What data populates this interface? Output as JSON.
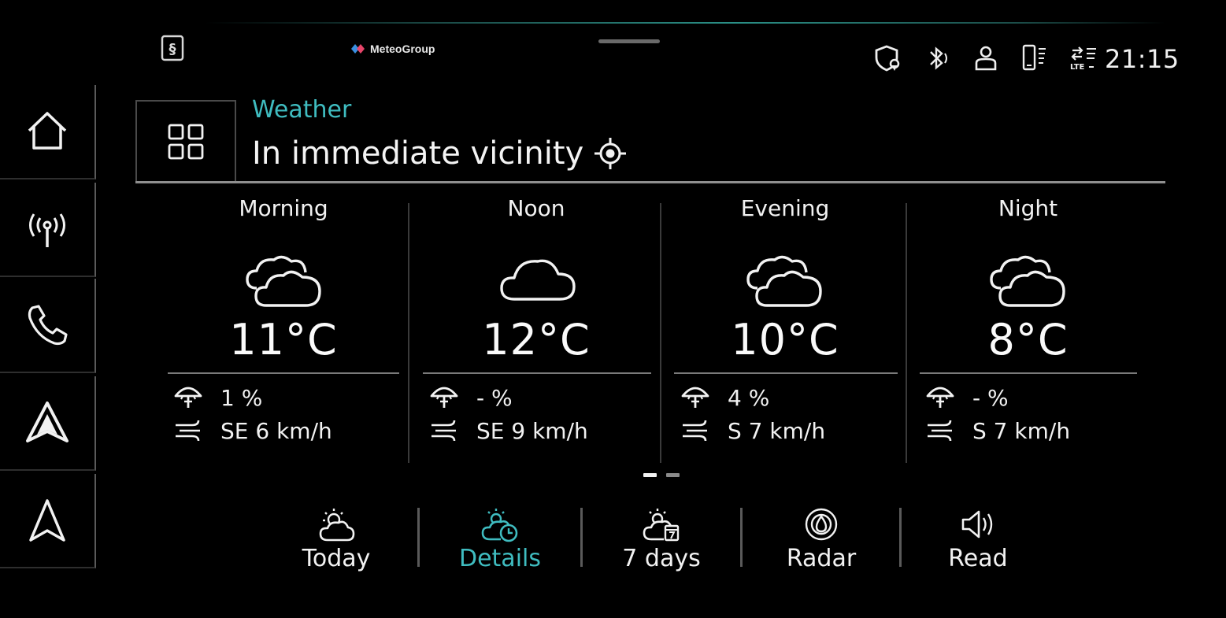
{
  "status_bar": {
    "brand": "MeteoGroup",
    "time": "21:15",
    "icons": [
      "shield-location-icon",
      "bluetooth-icon",
      "user-profile-icon",
      "phone-signal-icon",
      "lte-data-icon"
    ]
  },
  "rail": {
    "items": [
      {
        "name": "home-icon"
      },
      {
        "name": "radio-antenna-icon"
      },
      {
        "name": "phone-icon"
      },
      {
        "name": "android-auto-icon"
      },
      {
        "name": "navigation-arrow-icon"
      }
    ]
  },
  "header": {
    "app_title": "Weather",
    "location": "In immediate vicinity"
  },
  "forecast": [
    {
      "period": "Morning",
      "icon": "cloudy-icon",
      "temperature": "11°C",
      "precipitation": "1 %",
      "wind": "SE 6 km/h"
    },
    {
      "period": "Noon",
      "icon": "cloud-icon",
      "temperature": "12°C",
      "precipitation": "- %",
      "wind": "SE 9 km/h"
    },
    {
      "period": "Evening",
      "icon": "cloudy-icon",
      "temperature": "10°C",
      "precipitation": "4 %",
      "wind": "S 7 km/h"
    },
    {
      "period": "Night",
      "icon": "cloudy-icon",
      "temperature": "8°C",
      "precipitation": "- %",
      "wind": "S 7 km/h"
    }
  ],
  "pager": {
    "pages": 2,
    "current": 1
  },
  "tabs": [
    {
      "label": "Today",
      "icon": "sun-cloud-icon",
      "active": false
    },
    {
      "label": "Details",
      "icon": "sun-cloud-clock-icon",
      "active": true
    },
    {
      "label": "7 days",
      "icon": "sun-cloud-calendar-icon",
      "active": false
    },
    {
      "label": "Radar",
      "icon": "radar-icon",
      "active": false
    },
    {
      "label": "Read",
      "icon": "speaker-icon",
      "active": false
    }
  ],
  "colors": {
    "accent": "#3fbcc0",
    "text": "#f2f2f2",
    "background": "#000000"
  }
}
